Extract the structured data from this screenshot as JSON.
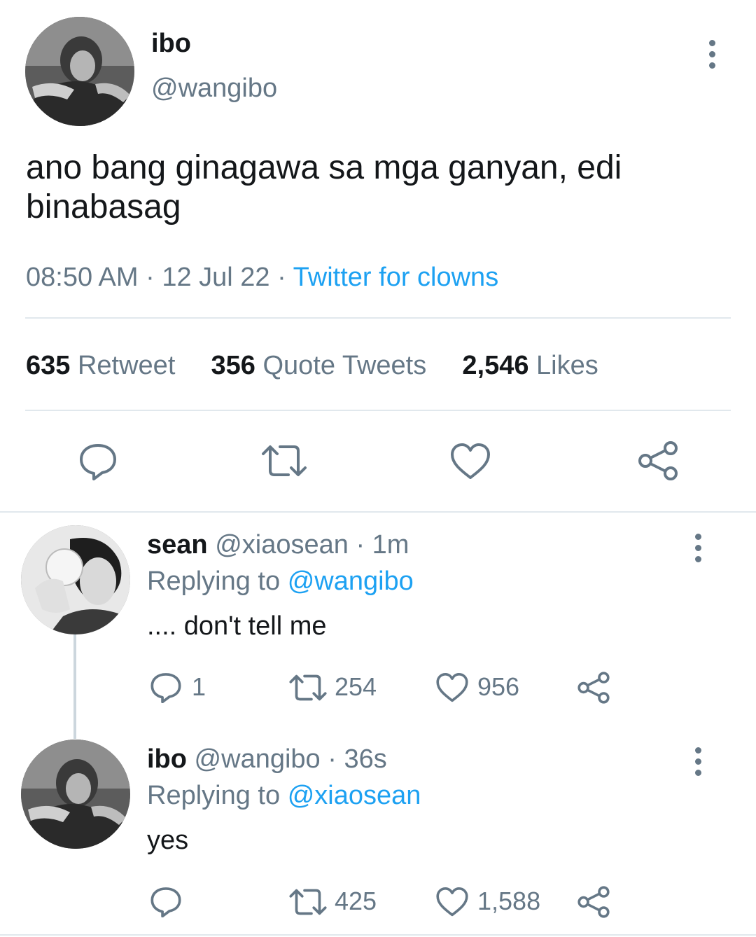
{
  "main_tweet": {
    "display_name": "ibo",
    "handle": "@wangibo",
    "text_line1": "ano bang ginagawa sa mga ganyan, edi",
    "text_line2": "binabasag",
    "time": "08:50 AM",
    "date": "12 Jul 22",
    "source": "Twitter for clowns",
    "separator": "·",
    "retweets_count": "635",
    "retweets_label": "Retweet",
    "quotes_count": "356",
    "quotes_label": "Quote Tweets",
    "likes_count": "2,546",
    "likes_label": "Likes"
  },
  "replies": [
    {
      "display_name": "sean",
      "handle": "@xiaosean",
      "time_ago": "· 1m",
      "replying_label": "Replying to",
      "replying_to": "@wangibo",
      "text": ".... don't tell me",
      "reply_count": "1",
      "retweet_count": "254",
      "like_count": "956"
    },
    {
      "display_name": "ibo",
      "handle": "@wangibo",
      "time_ago": "· 36s",
      "replying_label": "Replying to",
      "replying_to": "@xiaosean",
      "text": "yes",
      "reply_count": "",
      "retweet_count": "425",
      "like_count": "1,588"
    }
  ],
  "colors": {
    "link": "#1da1f2",
    "secondary_text": "#657786",
    "divider": "#e1e8ed"
  },
  "icons": [
    "more-vertical-icon",
    "reply-icon",
    "retweet-icon",
    "like-icon",
    "share-icon"
  ]
}
